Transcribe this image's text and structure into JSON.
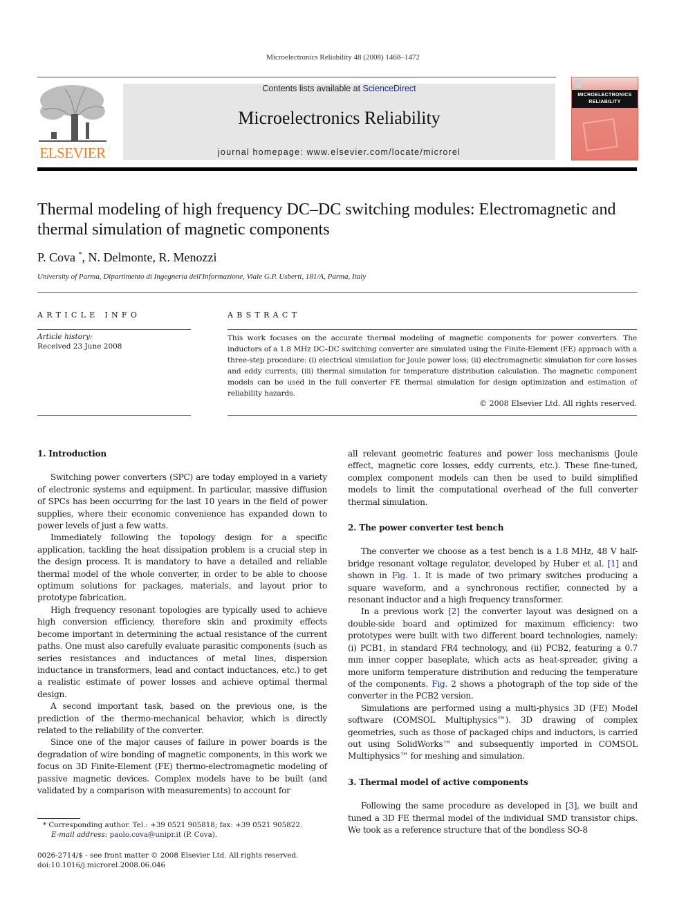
{
  "running_head": "Microelectronics Reliability 48 (2008) 1468–1472",
  "header": {
    "publisher_logo_label": "ELSEVIER",
    "contents_prefix": "Contents lists available at ",
    "contents_link": "ScienceDirect",
    "journal_name": "Microelectronics Reliability",
    "homepage": "journal homepage: www.elsevier.com/locate/microrel",
    "cover_title_line1": "MICROELECTRONICS",
    "cover_title_line2": "RELIABILITY",
    "colors": {
      "publisher_orange": "#f07f1b",
      "link_blue": "#1e2a8a",
      "banner_gray": "#e6e6e6",
      "cover_red": "#e77a70"
    }
  },
  "article": {
    "title": "Thermal modeling of high frequency DC–DC switching modules: Electromagnetic and thermal simulation of magnetic components",
    "authors_main": "P. Cova",
    "authors_star": "*",
    "authors_rest": ", N. Delmonte, R. Menozzi",
    "affiliation": "University of Parma, Dipartimento di Ingegneria dell'Informazione, Viale G.P. Usberti, 181/A, Parma, Italy"
  },
  "article_info": {
    "heading": "ARTICLE INFO",
    "history_label": "Article history:",
    "received": "Received 23 June 2008"
  },
  "abstract": {
    "heading": "ABSTRACT",
    "text": "This work focuses on the accurate thermal modeling of magnetic components for power converters. The inductors of a 1.8 MHz DC–DC switching converter are simulated using the Finite-Element (FE) approach with a three-step procedure: (i) electrical simulation for Joule power loss; (ii) electromagnetic simulation for core losses and eddy currents; (iii) thermal simulation for temperature distribution calculation. The magnetic component models can be used in the full converter FE thermal simulation for design optimization and estimation of reliability hazards.",
    "copyright": "© 2008 Elsevier Ltd. All rights reserved."
  },
  "sections": {
    "s1": {
      "heading": "1. Introduction",
      "p1": "Switching power converters (SPC) are today employed in a variety of electronic systems and equipment. In particular, massive diffusion of SPCs has been occurring for the last 10 years in the field of power supplies, where their economic convenience has expanded down to power levels of just a few watts.",
      "p2": "Immediately following the topology design for a specific application, tackling the heat dissipation problem is a crucial step in the design process. It is mandatory to have a detailed and reliable thermal model of the whole converter, in order to be able to choose optimum solutions for packages, materials, and layout prior to prototype fabrication.",
      "p3": "High frequency resonant topologies are typically used to achieve high conversion efficiency, therefore skin and proximity effects become important in determining the actual resistance of the current paths. One must also carefully evaluate parasitic components (such as series resistances and inductances of metal lines, dispersion inductance in transformers, lead and contact inductances, etc.) to get a realistic estimate of power losses and achieve optimal thermal design.",
      "p4": "A second important task, based on the previous one, is the prediction of the thermo-mechanical behavior, which is directly related to the reliability of the converter.",
      "p5": "Since one of the major causes of failure in power boards is the degradation of wire bonding of magnetic components, in this work we focus on 3D Finite-Element (FE) thermo-electromagnetic modeling of passive magnetic devices. Complex models have to be built (and validated by a comparison with measurements) to account for",
      "p5_cont": "all relevant geometric features and power loss mechanisms (Joule effect, magnetic core losses, eddy currents, etc.). These fine-tuned, complex component models can then be used to build simplified models to limit the computational overhead of the full converter thermal simulation."
    },
    "s2": {
      "heading": "2. The power converter test bench",
      "p1_a": "The converter we choose as a test bench is a 1.8 MHz, 48 V half-bridge resonant voltage regulator, developed by Huber et al. ",
      "p1_ref1": "[1]",
      "p1_b": " and shown in ",
      "p1_fig1": "Fig. 1",
      "p1_c": ". It is made of two primary switches producing a square waveform, and a synchronous rectifier, connected by a resonant inductor and a high frequency transformer.",
      "p2_a": "In a previous work ",
      "p2_ref2": "[2]",
      "p2_b": " the converter layout was designed on a double-side board and optimized for maximum efficiency: two prototypes were built with two different board technologies, namely: (i) PCB1, in standard FR4 technology, and (ii) PCB2, featuring a 0.7 mm inner copper baseplate, which acts as heat-spreader, giving a more uniform temperature distribution and reducing the temperature of the components. ",
      "p2_fig2": "Fig. 2",
      "p2_c": " shows a photograph of the top side of the converter in the PCB2 version.",
      "p3": "Simulations are performed using a multi-physics 3D (FE) Model software (COMSOL Multiphysics™). 3D drawing of complex geometries, such as those of packaged chips and inductors, is carried out using SolidWorks™ and subsequently imported in COMSOL Multiphysics™ for meshing and simulation."
    },
    "s3": {
      "heading": "3. Thermal model of active components",
      "p1_a": "Following the same procedure as developed in ",
      "p1_ref3": "[3]",
      "p1_b": ", we built and tuned a 3D FE thermal model of the individual SMD transistor chips. We took as a reference structure that of the bondless SO-8"
    }
  },
  "footnotes": {
    "corresponding": "* Corresponding author. Tel.: +39 0521 905818; fax: +39 0521 905822.",
    "email_label": "E-mail address: ",
    "email": "paolo.cova@unipr.it",
    "email_suffix": " (P. Cova).",
    "issn": "0026-2714/$ - see front matter © 2008 Elsevier Ltd. All rights reserved.",
    "doi": "doi:10.1016/j.microrel.2008.06.046"
  }
}
